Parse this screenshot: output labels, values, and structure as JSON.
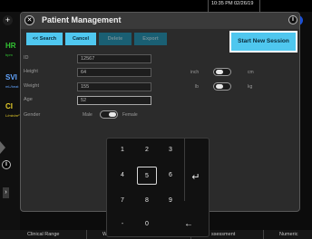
{
  "status": {
    "time": "10:35 PM",
    "date": "02/26/19"
  },
  "left_strip": {
    "hr_label": "HR",
    "hr_unit": "bpm",
    "svi_label": "SVI",
    "svi_unit": "mL/beat",
    "ci_label": "CI",
    "ci_unit": "L/min/m²"
  },
  "dialog": {
    "title": "Patient Management",
    "toolbar": {
      "search_label": "<< Search",
      "cancel_label": "Cancel",
      "delete_label": "Delete",
      "export_label": "Export",
      "new_session_label": "Start New Session"
    },
    "fields": {
      "id_label": "ID",
      "id_value": "12567",
      "height_label": "Height",
      "height_value": "64",
      "weight_label": "Weight",
      "weight_value": "155",
      "age_label": "Age",
      "age_value": "52",
      "gender_label": "Gender",
      "gender_male": "Male",
      "gender_female": "Female"
    },
    "units": {
      "height_left": "inch",
      "height_right": "cm",
      "weight_left": "lb",
      "weight_right": "kg"
    }
  },
  "keypad": {
    "keys": [
      "1",
      "2",
      "3",
      "4",
      "5",
      "6",
      "7",
      "8",
      "9",
      "-",
      "0"
    ],
    "enter_symbol": "↵",
    "backspace_symbol": "←"
  },
  "bottom_tabs": {
    "tab1": "Clinical Range",
    "tab2": "Wa",
    "tab3": "ssessment",
    "tab4": "Numeric"
  }
}
